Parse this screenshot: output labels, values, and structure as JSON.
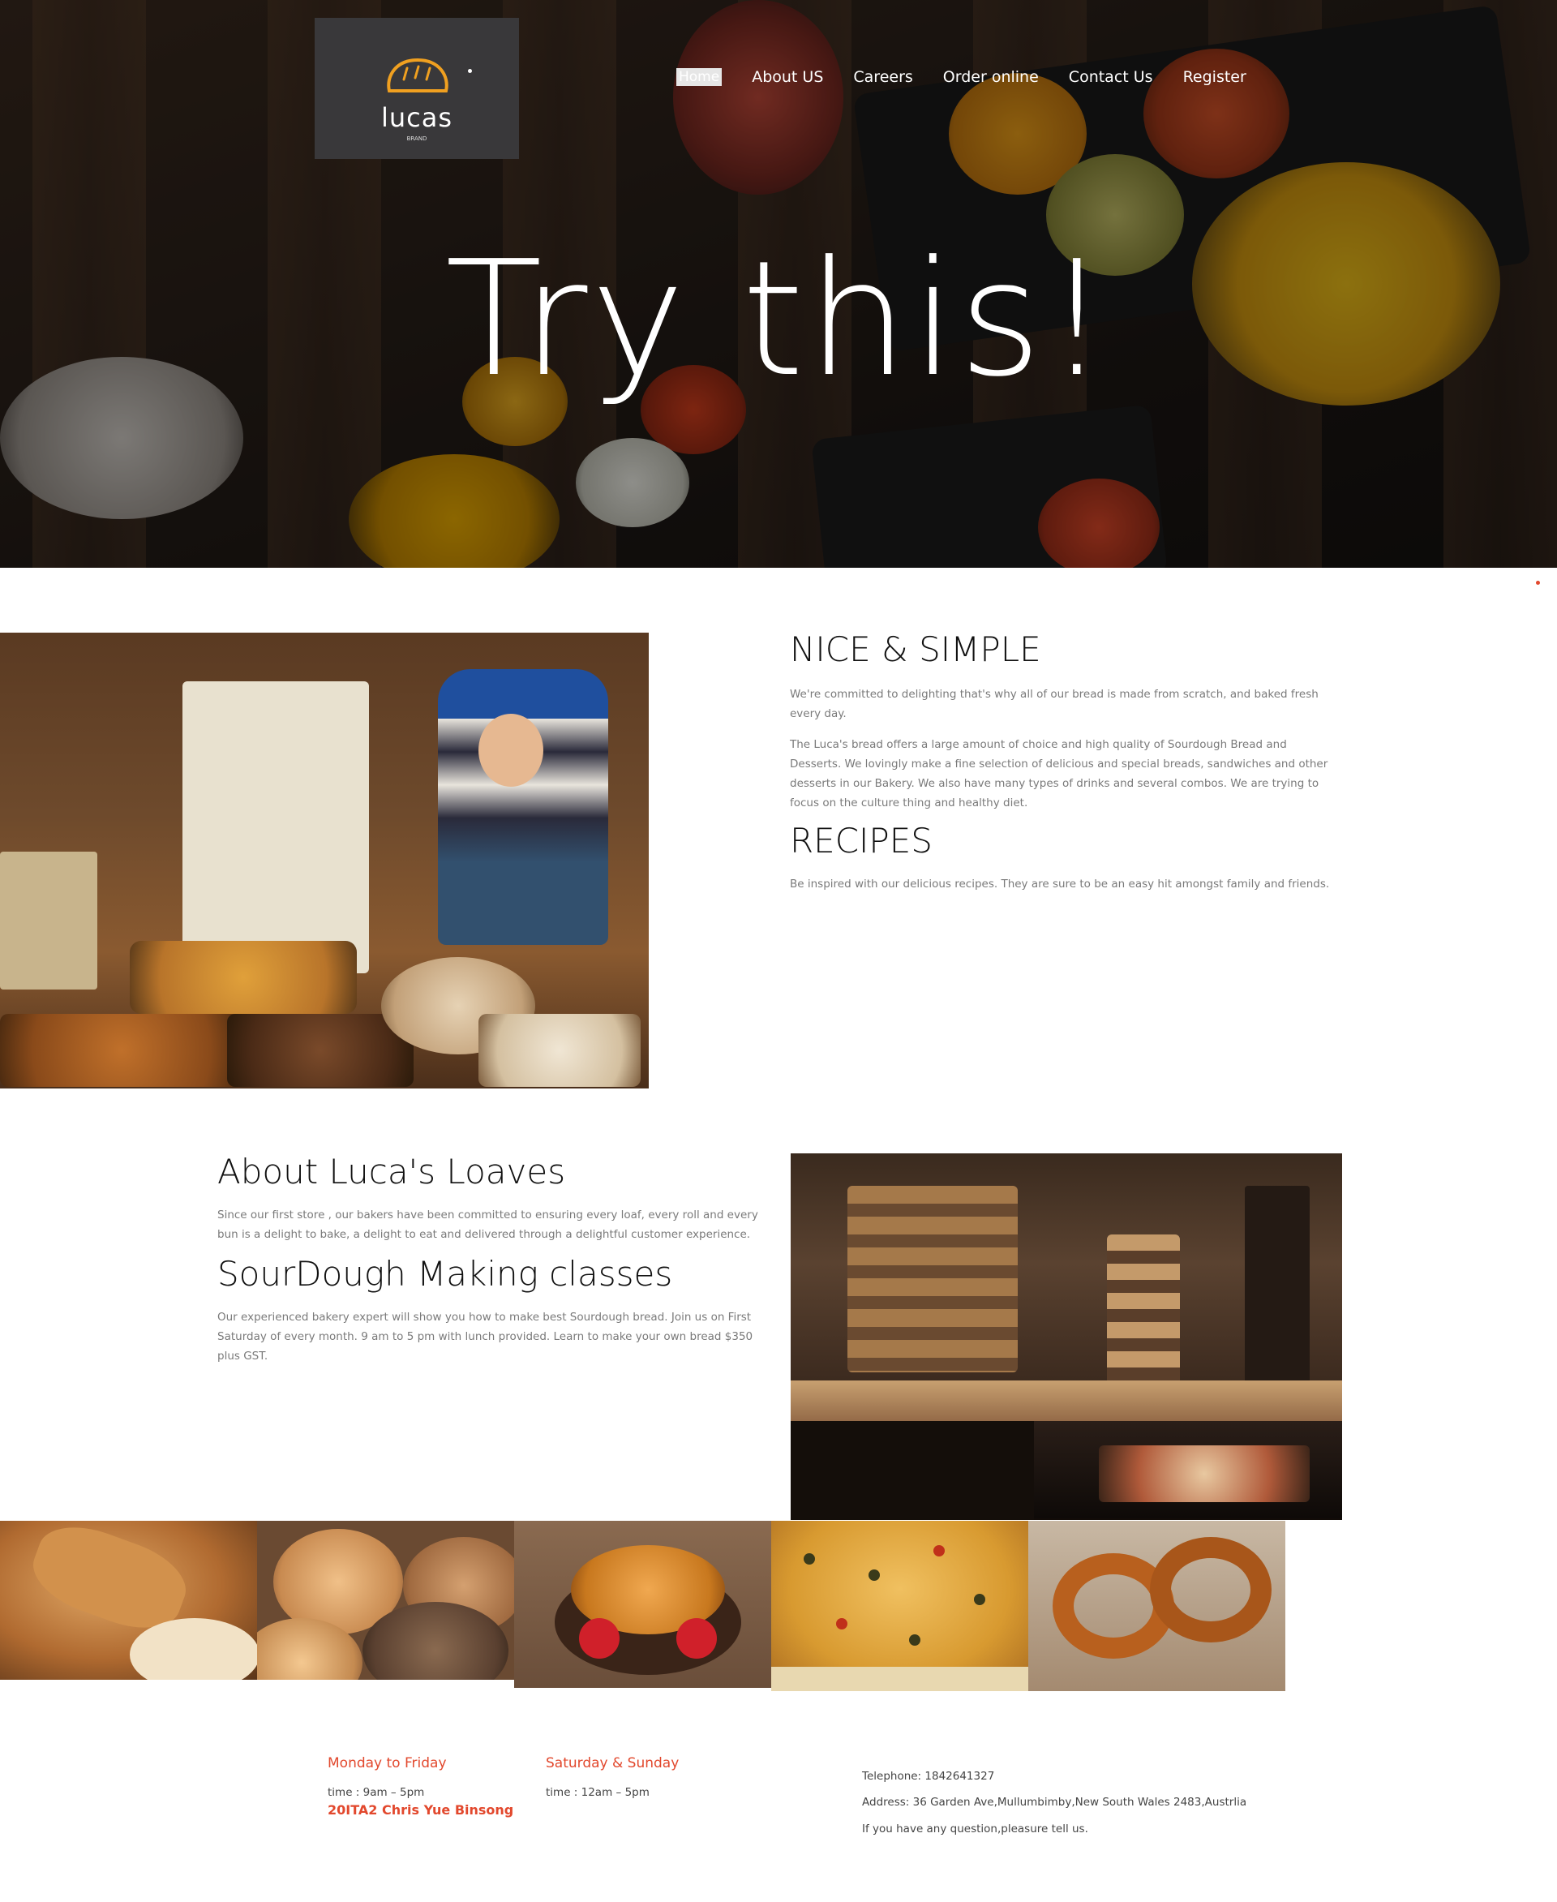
{
  "brand": {
    "name": "lucas",
    "sub": "BRAND"
  },
  "nav": {
    "items": [
      {
        "label": "Home",
        "active": true
      },
      {
        "label": "About US"
      },
      {
        "label": "Careers"
      },
      {
        "label": "Order online"
      },
      {
        "label": "Contact Us"
      },
      {
        "label": "Register"
      }
    ]
  },
  "hero": {
    "title": "Try this!"
  },
  "section1": {
    "heading1": "NICE & SIMPLE",
    "para1": "We're committed to delighting that's why all of our bread is made from scratch, and baked fresh every day.",
    "para2": "The Luca's bread offers a large amount of choice and high quality of Sourdough Bread and Desserts. We lovingly make a fine selection of delicious and special breads, sandwiches and other desserts in our Bakery. We also have many types of drinks and several combos. We are trying to focus on the culture thing and healthy diet.",
    "heading2": "RECIPES",
    "para3": "Be inspired with our delicious recipes. They are sure to be an easy hit amongst family and friends."
  },
  "section2": {
    "heading1": "About Luca's Loaves",
    "para1": "Since our first store , our bakers have been committed to ensuring every loaf, every roll and every bun is a delight to bake, a delight to eat and delivered through a delightful customer experience.",
    "heading2": "SourDough Making classes",
    "para2": "Our experienced bakery expert will show you how to make best Sourdough bread. Join us on First Saturday of every month. 9 am to 5 pm with lunch provided. Learn to make your own bread $350 plus GST."
  },
  "footer": {
    "weekday_title": "Monday to Friday",
    "weekday_time": "time : 9am – 5pm",
    "credit": "20ITA2 Chris Yue Binsong",
    "weekend_title": "Saturday & Sunday",
    "weekend_time": "time : 12am – 5pm",
    "telephone": "Telephone: 1842641327",
    "address": "Address: 36 Garden Ave,Mullumbimby,New South Wales 2483,Austrlia",
    "question": "If you have any question,pleasure tell us."
  },
  "colors": {
    "accent": "#e2482d",
    "logo_bg": "#39383a",
    "loaf_outline": "#f0a020"
  },
  "icons": {
    "logo": "bread-loaf-icon"
  }
}
